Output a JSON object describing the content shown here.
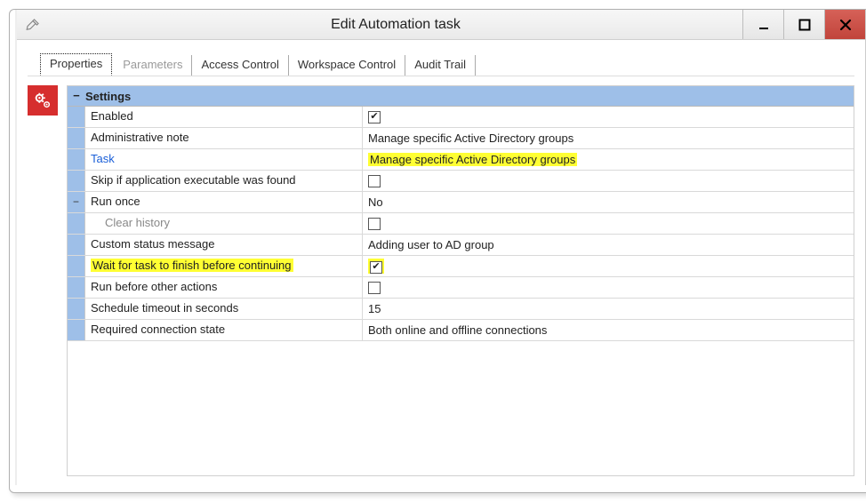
{
  "window": {
    "title": "Edit Automation task",
    "min_label": "–",
    "max_label": "◻",
    "close_label": "✕"
  },
  "tabs": {
    "properties": "Properties",
    "parameters": "Parameters",
    "access": "Access Control",
    "workspace": "Workspace Control",
    "audit": "Audit Trail"
  },
  "section_header": "Settings",
  "rows": {
    "enabled": {
      "label": "Enabled",
      "checked": true
    },
    "admin_note": {
      "label": "Administrative note",
      "value": "Manage specific Active Directory groups"
    },
    "task": {
      "label": "Task",
      "value": "Manage specific Active Directory groups"
    },
    "skip_if_exe": {
      "label": "Skip if application executable was found",
      "checked": false
    },
    "run_once": {
      "label": "Run once",
      "value": "No"
    },
    "clear_history": {
      "label": "Clear history",
      "checked": false
    },
    "custom_status": {
      "label": "Custom status message",
      "value": "Adding user to AD group"
    },
    "wait_finish": {
      "label": "Wait for task to finish before continuing",
      "checked": true
    },
    "run_before": {
      "label": "Run before other actions",
      "checked": false
    },
    "schedule_timeout": {
      "label": "Schedule timeout in seconds",
      "value": "15"
    },
    "conn_state": {
      "label": "Required connection state",
      "value": "Both online and offline connections"
    }
  }
}
